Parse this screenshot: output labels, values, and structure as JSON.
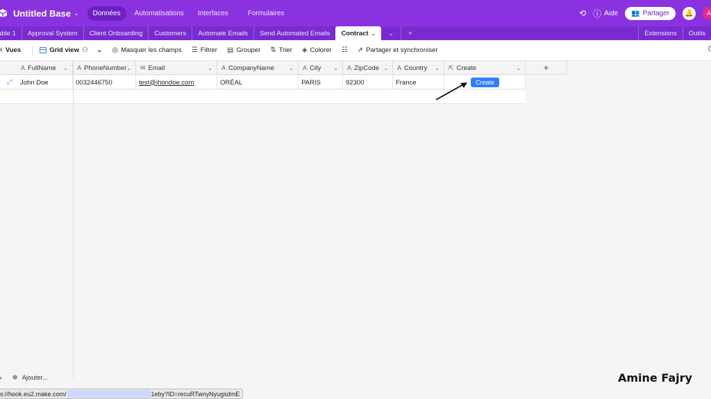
{
  "topbar": {
    "base_title": "Untitled Base",
    "nav": [
      "Données",
      "Automatisations",
      "Interfaces",
      "Formulaires"
    ],
    "help_label": "Aide",
    "share_label": "Partager",
    "avatar_initial": "A"
  },
  "tabs": {
    "items": [
      "able 1",
      "Approval System",
      "Client Onboarding",
      "Customers",
      "Automate Emails",
      "Send Automated Emails"
    ],
    "active": "Contract",
    "right": [
      "Extensions",
      "Outils"
    ]
  },
  "viewbar": {
    "views_label": "Vues",
    "grid_view_label": "Grid view",
    "hide_fields_label": "Masquer les champs",
    "filter_label": "Filtrer",
    "group_label": "Grouper",
    "sort_label": "Trier",
    "color_label": "Colorer",
    "share_sync_label": "Partager et synchroniser"
  },
  "table": {
    "columns": [
      "FullName",
      "PhoneNumber",
      "Email",
      "CompanyName",
      "City",
      "ZipCode",
      "Country",
      "Create"
    ],
    "rows": [
      {
        "FullName": "John Doe",
        "PhoneNumber": "0032446750",
        "Email": "test@jhondoe.com",
        "CompanyName": "ORÉAL",
        "City": "PARIS",
        "ZipCode": "92300",
        "Country": "France",
        "Create": "Create"
      }
    ]
  },
  "footer": {
    "add_label": "Ajouter...",
    "status_url_start": "s://hook.eu2.make.com/",
    "status_url_end": "1eby?ID=recuRTwnyNyugsdmE",
    "watermark": "Amine Fajry"
  }
}
